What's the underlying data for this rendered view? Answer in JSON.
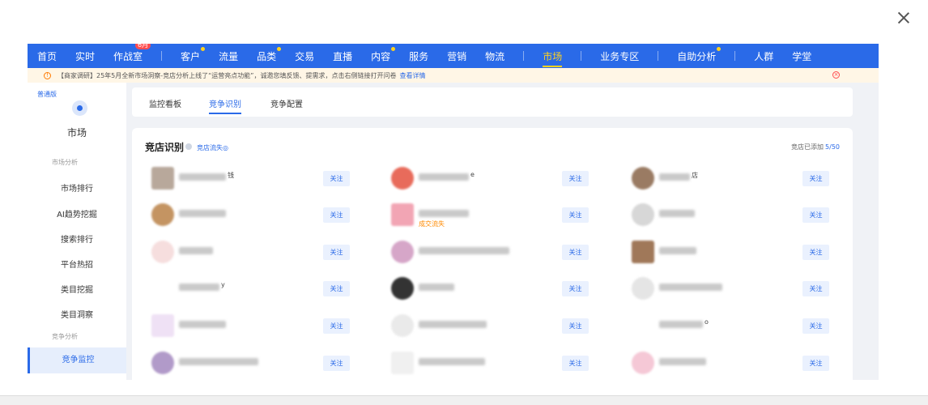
{
  "nav": {
    "items": [
      {
        "label": "首页",
        "dot": false
      },
      {
        "label": "实时",
        "dot": false
      },
      {
        "label": "作战室",
        "dot": false,
        "badge": "6月"
      },
      {
        "sep": true
      },
      {
        "label": "客户",
        "dot": true
      },
      {
        "label": "流量",
        "dot": false
      },
      {
        "label": "品类",
        "dot": true
      },
      {
        "label": "交易",
        "dot": false
      },
      {
        "label": "直播",
        "dot": false
      },
      {
        "label": "内容",
        "dot": true
      },
      {
        "label": "服务",
        "dot": false
      },
      {
        "label": "营销",
        "dot": false
      },
      {
        "label": "物流",
        "dot": false
      },
      {
        "sep": true
      },
      {
        "label": "市场",
        "dot": false,
        "active": true
      },
      {
        "sep": true
      },
      {
        "label": "业务专区",
        "dot": false
      },
      {
        "sep": true
      },
      {
        "label": "自助分析",
        "dot": true
      },
      {
        "sep": true
      },
      {
        "label": "人群",
        "dot": false
      },
      {
        "label": "学堂",
        "dot": false
      }
    ]
  },
  "notice": {
    "text": "【商家调研】25年5月全新市场洞察-竞店分析上线了“运营亮点功能”，诚邀您填反馈、提需求，点击右侧链接打开问卷",
    "link": "查看详情"
  },
  "sidebar": {
    "edition": "普通版",
    "title": "市场",
    "group1": "市场分析",
    "items": [
      "市场排行",
      "AI趋势挖掘",
      "搜索排行",
      "平台热招",
      "类目挖掘",
      "类目洞察"
    ],
    "group2": "竞争分析",
    "active_item": "竞争监控"
  },
  "tabs": [
    "监控看板",
    "竞争识别",
    "竞争配置"
  ],
  "card": {
    "title": "竞店识别",
    "lost_link": "竞店流失◎",
    "added_label": "竞店已添加",
    "added_count": "5/50",
    "follow_label": "关注"
  },
  "shops": [
    {
      "tail": "钱",
      "lost": ""
    },
    {
      "tail": "e",
      "lost": ""
    },
    {
      "tail": "店",
      "lost": ""
    },
    {
      "tail": "",
      "lost": ""
    },
    {
      "tail": "",
      "lost": "成交流失"
    },
    {
      "tail": "",
      "lost": ""
    },
    {
      "tail": "",
      "lost": ""
    },
    {
      "tail": "",
      "lost": ""
    },
    {
      "tail": "",
      "lost": ""
    },
    {
      "tail": "y",
      "lost": ""
    },
    {
      "tail": "",
      "lost": ""
    },
    {
      "tail": "",
      "lost": ""
    },
    {
      "tail": "",
      "lost": ""
    },
    {
      "tail": "",
      "lost": ""
    },
    {
      "tail": "o",
      "lost": ""
    },
    {
      "tail": "",
      "lost": ""
    },
    {
      "tail": "",
      "lost": ""
    },
    {
      "tail": "",
      "lost": ""
    }
  ],
  "colors": {
    "nav_bg": "#2a6ae8",
    "accent": "#2a6ae8",
    "active_nav": "#ffd21f",
    "lost_tag": "#ff8a00"
  }
}
